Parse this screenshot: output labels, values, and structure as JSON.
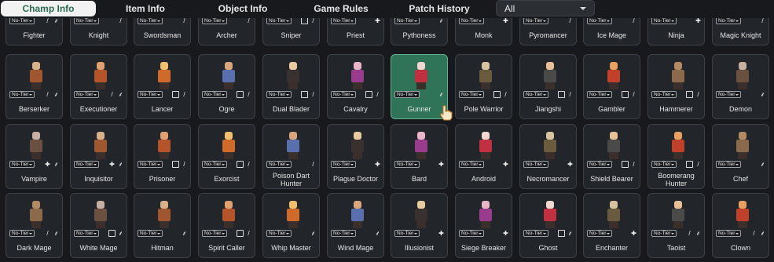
{
  "tabs": [
    {
      "label": "Champ Info",
      "active": true
    },
    {
      "label": "Item Info",
      "active": false
    },
    {
      "label": "Object Info",
      "active": false
    },
    {
      "label": "Game Rules",
      "active": false
    },
    {
      "label": "Patch History",
      "active": false
    }
  ],
  "filter": {
    "value": "All"
  },
  "tier_label": "No-Tier",
  "rows": [
    [
      {
        "name": "Fighter",
        "icons": [
          "sword",
          "swirl"
        ]
      },
      {
        "name": "Knight",
        "icons": [
          "sword"
        ]
      },
      {
        "name": "Swordsman",
        "icons": [
          "sword"
        ]
      },
      {
        "name": "Archer",
        "icons": [
          "sword"
        ]
      },
      {
        "name": "Sniper",
        "icons": [
          "box",
          "sword"
        ]
      },
      {
        "name": "Priest",
        "icons": [
          "cross"
        ]
      },
      {
        "name": "Pythoness",
        "icons": [
          "swirl"
        ]
      },
      {
        "name": "Monk",
        "icons": [
          "cross"
        ]
      },
      {
        "name": "Pyromancer",
        "icons": [
          "sword"
        ]
      },
      {
        "name": "Ice Mage",
        "icons": [
          "sword"
        ]
      },
      {
        "name": "Ninja",
        "icons": [
          "cross"
        ]
      },
      {
        "name": "Magic Knight",
        "icons": [
          "sword"
        ]
      }
    ],
    [
      {
        "name": "Berserker",
        "icons": [
          "sword",
          "swirl"
        ]
      },
      {
        "name": "Executioner",
        "icons": [
          "sword",
          "swirl"
        ]
      },
      {
        "name": "Lancer",
        "icons": [
          "box",
          "sword"
        ]
      },
      {
        "name": "Ogre",
        "icons": [
          "box",
          "sword"
        ]
      },
      {
        "name": "Dual Blader",
        "icons": [
          "box",
          "sword"
        ]
      },
      {
        "name": "Cavalry",
        "icons": [
          "box",
          "sword"
        ]
      },
      {
        "name": "Gunner",
        "icons": [
          "swirl"
        ]
      },
      {
        "name": "Pole Warrior",
        "icons": [
          "box",
          "sword"
        ]
      },
      {
        "name": "Jiangshi",
        "icons": [
          "box",
          "sword"
        ]
      },
      {
        "name": "Gambler",
        "icons": [
          "box",
          "sword"
        ]
      },
      {
        "name": "Hammerer",
        "icons": [
          "box",
          "sword"
        ]
      },
      {
        "name": "Demon",
        "icons": [
          "swirl"
        ]
      }
    ],
    [
      {
        "name": "Vampire",
        "icons": [
          "cross",
          "swirl"
        ]
      },
      {
        "name": "Inquisitor",
        "icons": [
          "cross",
          "swirl"
        ]
      },
      {
        "name": "Prisoner",
        "icons": [
          "box",
          "sword"
        ]
      },
      {
        "name": "Exorcist",
        "icons": [
          "box",
          "sword"
        ]
      },
      {
        "name": "Poison Dart Hunter",
        "icons": [
          "sword"
        ]
      },
      {
        "name": "Plague Doctor",
        "icons": [
          "cross"
        ]
      },
      {
        "name": "Bard",
        "icons": [
          "cross"
        ]
      },
      {
        "name": "Android",
        "icons": [
          "cross"
        ]
      },
      {
        "name": "Necromancer",
        "icons": [
          "cross"
        ]
      },
      {
        "name": "Shield Bearer",
        "icons": [
          "box",
          "sword"
        ]
      },
      {
        "name": "Boomerang Hunter",
        "icons": [
          "box",
          "sword"
        ]
      },
      {
        "name": "Chef",
        "icons": [
          "swirl"
        ]
      }
    ],
    [
      {
        "name": "Dark Mage",
        "icons": [
          "sword",
          "swirl"
        ]
      },
      {
        "name": "White Mage",
        "icons": [
          "box",
          "swirl"
        ]
      },
      {
        "name": "Hitman",
        "icons": [
          "swirl"
        ]
      },
      {
        "name": "Spirit Caller",
        "icons": [
          "box",
          "sword"
        ]
      },
      {
        "name": "Whip Master",
        "icons": [
          "swirl"
        ]
      },
      {
        "name": "Wind Mage",
        "icons": [
          "swirl"
        ]
      },
      {
        "name": "Illusionist",
        "icons": [
          "cross"
        ]
      },
      {
        "name": "Siege Breaker",
        "icons": [
          "cross"
        ]
      },
      {
        "name": "Ghost",
        "icons": [
          "box",
          "swirl"
        ]
      },
      {
        "name": "Enchanter",
        "icons": [
          "cross"
        ]
      },
      {
        "name": "Taoist",
        "icons": [
          "sword",
          "swirl"
        ]
      },
      {
        "name": "Clown",
        "icons": [
          "sword",
          "swirl"
        ]
      }
    ]
  ],
  "selected": "Gunner",
  "colors": {
    "background": "#17191c",
    "card": "#22252a",
    "card_border": "#3d4147",
    "selected_card": "#2f7358",
    "active_tab_text": "#2a6a4e"
  }
}
